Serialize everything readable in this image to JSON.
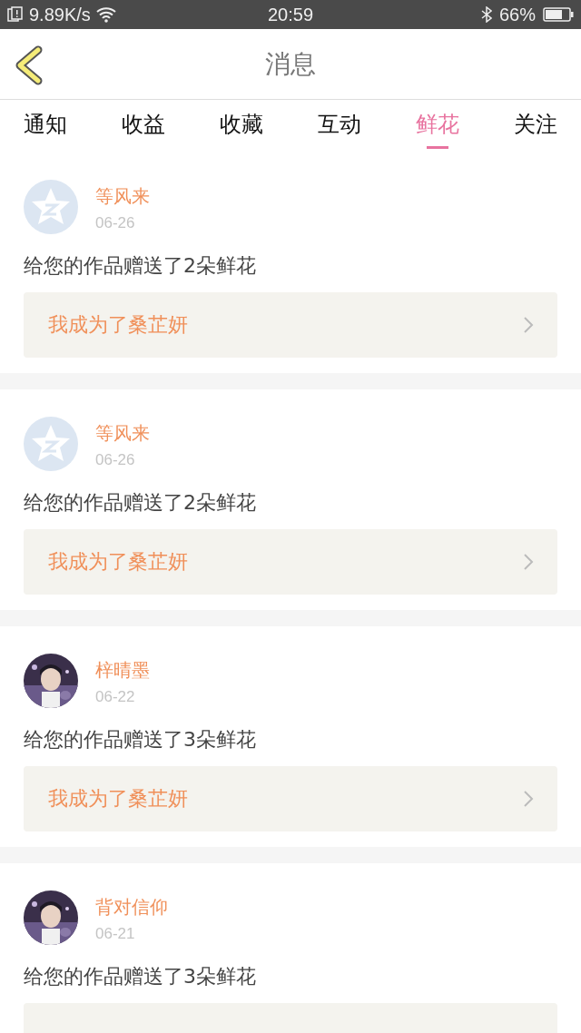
{
  "status_bar": {
    "speed": "9.89K/s",
    "time": "20:59",
    "battery": "66%"
  },
  "header": {
    "title": "消息"
  },
  "tabs": [
    {
      "label": "通知",
      "selected": false
    },
    {
      "label": "收益",
      "selected": false
    },
    {
      "label": "收藏",
      "selected": false
    },
    {
      "label": "互动",
      "selected": false
    },
    {
      "label": "鲜花",
      "selected": true
    },
    {
      "label": "关注",
      "selected": false
    }
  ],
  "messages": [
    {
      "avatar": {
        "kind": "default"
      },
      "name": "等风来",
      "date": "06-26",
      "text": "给您的作品赠送了2朵鲜花",
      "link_box": true,
      "work": "我成为了桑芷妍"
    },
    {
      "avatar": {
        "kind": "default"
      },
      "name": "等风来",
      "date": "06-26",
      "text": "给您的作品赠送了2朵鲜花",
      "link_box": true,
      "work": "我成为了桑芷妍"
    },
    {
      "name": "梓晴墨",
      "date": "06-22",
      "text": "给您的作品赠送了3朵鲜花",
      "link_box": true,
      "work": "我成为了桑芷妍"
    },
    {
      "name": "背对信仰",
      "date": "06-21",
      "text": "给您的作品赠送了3朵鲜花",
      "link_box": true
    }
  ]
}
